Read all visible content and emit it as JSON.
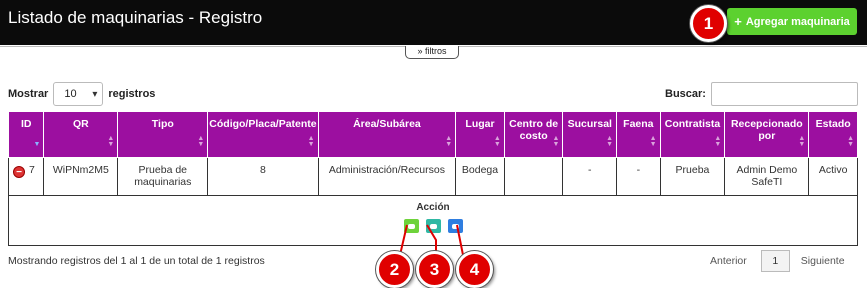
{
  "header": {
    "title": "Listado de maquinarias - Registro",
    "add_button": "Agregar maquinaria",
    "add_button_icon": "plus-icon",
    "accent": "#5cd12f"
  },
  "filters_tab": "» filtros",
  "length_control": {
    "prefix": "Mostrar",
    "value": "10",
    "suffix": "registros"
  },
  "search": {
    "label": "Buscar:",
    "value": ""
  },
  "table": {
    "header_color": "#9c0fa0",
    "columns": [
      "ID",
      "QR",
      "Tipo",
      "Código/Placa/Patente",
      "Área/Subárea",
      "Lugar",
      "Centro de costo",
      "Sucursal",
      "Faena",
      "Contratista",
      "Recepcionado por",
      "Estado"
    ],
    "row": {
      "id": "7",
      "qr": "WiPNm2M5",
      "tipo": "Prueba de maquinarias",
      "codigo": "8",
      "area": "Administración/Recursos",
      "lugar": "Bodega",
      "centro": "",
      "sucursal": "-",
      "faena": "-",
      "contratista": "Prueba",
      "recepcionado": "Admin Demo SafeTI",
      "estado": "Activo"
    },
    "child_label": "Acción",
    "actions": [
      {
        "icon": "eye-icon",
        "color": "#6ed33a"
      },
      {
        "icon": "image-icon",
        "color": "#2fb8a4"
      },
      {
        "icon": "document-icon",
        "color": "#2f7ee0"
      }
    ]
  },
  "info": "Mostrando registros del 1 al 1 de un total de 1 registros",
  "pagination": {
    "previous": "Anterior",
    "current": "1",
    "next": "Siguiente"
  },
  "callouts": [
    "1",
    "2",
    "3",
    "4"
  ],
  "callout_color": "#e00000"
}
